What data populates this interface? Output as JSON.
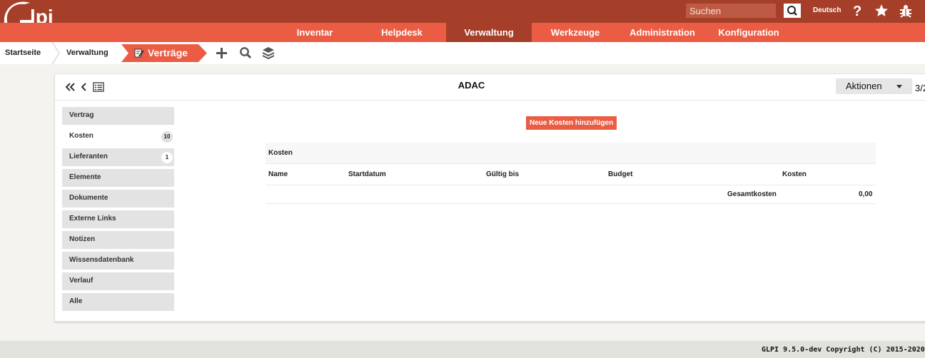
{
  "header": {
    "logo_text": "Glpi",
    "search_placeholder": "Suchen",
    "language": "Deutsch",
    "icons": [
      "help-icon",
      "star-icon",
      "bug-icon",
      "search-icon"
    ]
  },
  "menu": {
    "items": [
      {
        "label": "Inventar"
      },
      {
        "label": "Helpdesk"
      },
      {
        "label": "Verwaltung"
      },
      {
        "label": "Werkzeuge"
      },
      {
        "label": "Administration"
      },
      {
        "label": "Konfiguration"
      }
    ],
    "active": "Verwaltung"
  },
  "breadcrumb": {
    "items": [
      "Startseite",
      "Verwaltung"
    ],
    "current": "Verträge",
    "icons": [
      "contract-icon",
      "plus-icon",
      "search-icon",
      "layers-icon"
    ]
  },
  "item": {
    "title": "ADAC",
    "actions_label": "Aktionen",
    "pager": "3/2"
  },
  "tabs": [
    {
      "label": "Vertrag",
      "badge": null
    },
    {
      "label": "Kosten",
      "badge": "10"
    },
    {
      "label": "Lieferanten",
      "badge": "1"
    },
    {
      "label": "Elemente",
      "badge": null
    },
    {
      "label": "Dokumente",
      "badge": null
    },
    {
      "label": "Externe Links",
      "badge": null
    },
    {
      "label": "Notizen",
      "badge": null
    },
    {
      "label": "Wissensdatenbank",
      "badge": null
    },
    {
      "label": "Verlauf",
      "badge": null
    },
    {
      "label": "Alle",
      "badge": null
    }
  ],
  "active_tab": "Kosten",
  "costs": {
    "add_button": "Neue Kosten hinzufügen",
    "caption": "Kosten",
    "columns": [
      "Name",
      "Startdatum",
      "Gültig bis",
      "Budget",
      "Kosten"
    ],
    "total_label": "Gesamtkosten",
    "total_value": "0,00"
  },
  "colors": {
    "top": "#a63f29",
    "menu": "#ea5d44",
    "accent": "#ea5d44"
  },
  "footer": {
    "text": "GLPI 9.5.0-dev Copyright (C) 2015-2020"
  }
}
